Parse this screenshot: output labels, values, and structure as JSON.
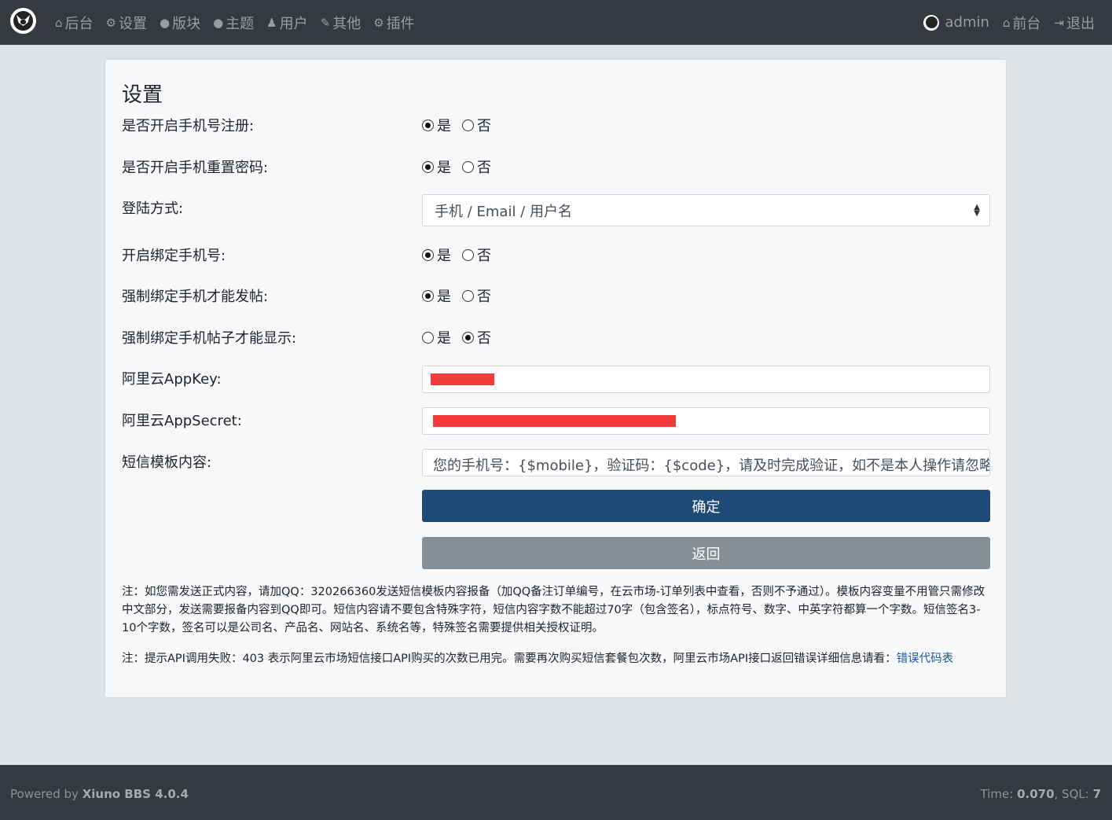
{
  "header": {
    "nav_left": [
      {
        "icon": "home-icon",
        "glyph": "⌂",
        "label": "后台"
      },
      {
        "icon": "gear-icon",
        "glyph": "⚙",
        "label": "设置"
      },
      {
        "icon": "comment-icon",
        "glyph": "●",
        "label": "版块"
      },
      {
        "icon": "comments-icon",
        "glyph": "●",
        "label": "主题"
      },
      {
        "icon": "user-icon",
        "glyph": "♟",
        "label": "用户"
      },
      {
        "icon": "wrench-icon",
        "glyph": "✎",
        "label": "其他"
      },
      {
        "icon": "cogs-icon",
        "glyph": "⚙",
        "label": "插件"
      }
    ],
    "user": "admin",
    "frontend": "前台",
    "logout": "退出"
  },
  "page": {
    "title": "设置",
    "mobile_register": {
      "label": "是否开启手机号注册:",
      "yes": "是",
      "no": "否",
      "value": "yes"
    },
    "mobile_reset": {
      "label": "是否开启手机重置密码:",
      "yes": "是",
      "no": "否",
      "value": "yes"
    },
    "login_method": {
      "label": "登陆方式:",
      "value": "手机 / Email / 用户名"
    },
    "bind_mobile": {
      "label": "开启绑定手机号:",
      "yes": "是",
      "no": "否",
      "value": "yes"
    },
    "force_bind_post": {
      "label": "强制绑定手机才能发帖:",
      "yes": "是",
      "no": "否",
      "value": "yes"
    },
    "force_bind_view": {
      "label": "强制绑定手机帖子才能显示:",
      "yes": "是",
      "no": "否",
      "value": "no"
    },
    "appkey": {
      "label": "阿里云AppKey:"
    },
    "appsecret": {
      "label": "阿里云AppSecret:"
    },
    "sms_template": {
      "label": "短信模板内容:",
      "value": "您的手机号：{$mobile}，验证码：{$code}，请及时完成验证，如不是本人操作请忽略。【"
    },
    "submit": "确定",
    "back": "返回",
    "note1": "注：如您需发送正式内容，请加QQ：320266360发送短信模板内容报备（加QQ备注订单编号，在云市场-订单列表中查看，否则不予通过）。模板内容变量不用管只需修改中文部分，发送需要报备内容到QQ即可。短信内容请不要包含特殊字符，短信内容字数不能超过70字（包含签名），标点符号、数字、中英字符都算一个字数。短信签名3-10个字数，签名可以是公司名、产品名、网站名、系统名等，特殊签名需要提供相关授权证明。",
    "note2": "注：提示API调用失败：403 表示阿里云市场短信接口API购买的次数已用完。需要再次购买短信套餐包次数，阿里云市场API接口返回错误详细信息请看：",
    "note2_link": "错误代码表"
  },
  "footer": {
    "powered_prefix": "Powered by ",
    "powered_name": "Xiuno BBS 4.0.4",
    "time_label": "Time: ",
    "time_value": "0.070",
    "sql_label": ", SQL: ",
    "sql_value": "7"
  }
}
